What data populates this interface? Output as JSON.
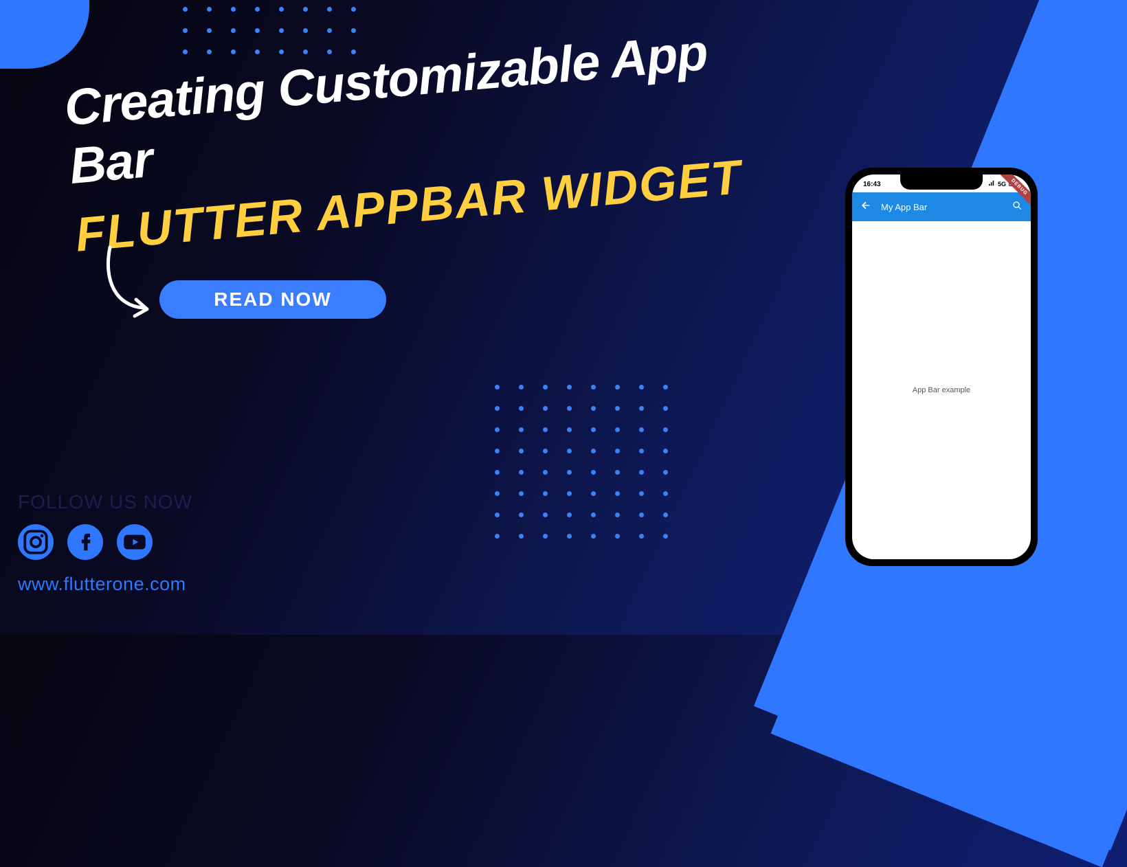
{
  "headline": {
    "line1": "Creating Customizable App Bar",
    "line2": "FLUTTER APPBAR WIDGET"
  },
  "cta_label": "READ NOW",
  "footer": {
    "follow_label": "FOLLOW US NOW",
    "site_url": "www.flutterone.com",
    "socials": [
      "instagram",
      "facebook",
      "youtube"
    ]
  },
  "phone": {
    "status": {
      "time": "16:43",
      "network": "5G"
    },
    "appbar": {
      "title": "My App Bar"
    },
    "debug_badge": "DEBUG",
    "body_text": "App Bar example"
  },
  "icons": {
    "back": "←",
    "search": "search"
  }
}
